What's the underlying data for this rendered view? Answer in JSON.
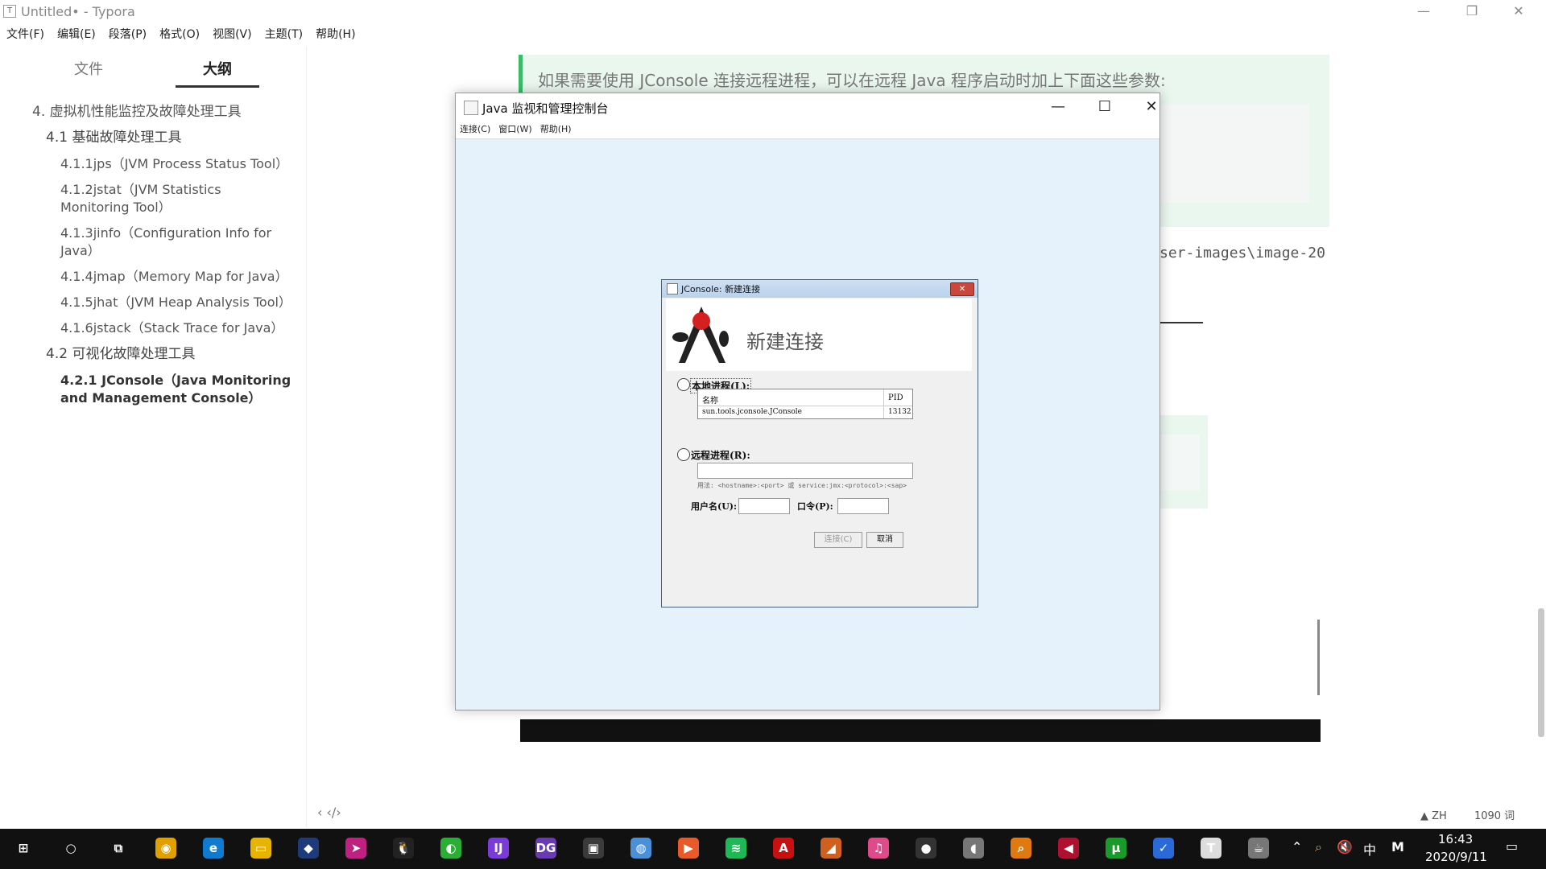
{
  "typora": {
    "title": "Untitled• - Typora",
    "controls": {
      "minimize": "—",
      "restore": "❐",
      "close": "✕"
    },
    "menu": [
      "文件(F)",
      "编辑(E)",
      "段落(P)",
      "格式(O)",
      "视图(V)",
      "主题(T)",
      "帮助(H)"
    ],
    "sidebar_tabs": {
      "files": "文件",
      "outline": "大纲"
    },
    "outline": [
      {
        "text": "4. 虚拟机性能监控及故障处理工具",
        "level": 1
      },
      {
        "text": "4.1 基础故障处理工具",
        "level": 2
      },
      {
        "text": "4.1.1jps（JVM Process Status Tool）",
        "level": 3
      },
      {
        "text": "4.1.2jstat（JVM Statistics Monitoring Tool）",
        "level": 3
      },
      {
        "text": "4.1.3jinfo（Configuration Info for Java）",
        "level": 3
      },
      {
        "text": "4.1.4jmap（Memory Map for Java）",
        "level": 3
      },
      {
        "text": "4.1.5jhat（JVM Heap Analysis Tool）",
        "level": 3
      },
      {
        "text": "4.1.6jstack（Stack Trace for Java）",
        "level": 3
      },
      {
        "text": "4.2 可视化故障处理工具",
        "level": 2
      },
      {
        "text": "4.2.1 JConsole（Java Monitoring and Management Console）",
        "level": 3,
        "active": true
      }
    ],
    "blockquote": "如果需要使用 JConsole 连接远程进程，可以在远程 Java 程序启动时加上下面这些参数:",
    "path_fragment": "ser-images\\image-20",
    "status": {
      "left_icons": "‹  ‹/›",
      "lang": "ZH",
      "word_count": "1090 词"
    }
  },
  "java_window": {
    "title": "Java 监视和管理控制台",
    "controls": {
      "minimize": "—",
      "maximize": "☐",
      "close": "✕"
    },
    "menu": [
      "连接(C)",
      "窗口(W)",
      "帮助(H)"
    ]
  },
  "dialog": {
    "title": "JConsole: 新建连接",
    "close": "✕",
    "heading": "新建连接",
    "local_label": "本地进程(L):",
    "table_headers": {
      "name": "名称",
      "pid": "PID"
    },
    "process": {
      "name": "sun.tools.jconsole.JConsole",
      "pid": "13132"
    },
    "remote_label": "远程进程(R):",
    "remote_value": "",
    "usage": "用法: <hostname>:<port> 或 service:jmx:<protocol>:<sap>",
    "username_label": "用户名(U):",
    "password_label": "口令(P):",
    "connect_btn": "连接(C)",
    "cancel_btn": "取消"
  },
  "taskbar": {
    "time": "16:43",
    "date": "2020/9/11",
    "ime": "中",
    "ime2": "M",
    "icons": [
      {
        "name": "windows-start-icon",
        "color": "#111",
        "glyph": "⊞"
      },
      {
        "name": "cortana-icon",
        "color": "#111",
        "glyph": "○"
      },
      {
        "name": "task-view-icon",
        "color": "#111",
        "glyph": "⧉"
      },
      {
        "name": "chrome-icon",
        "color": "#e0a000",
        "glyph": "◉"
      },
      {
        "name": "edge-icon",
        "color": "#0f7bd0",
        "glyph": "e"
      },
      {
        "name": "file-explorer-icon",
        "color": "#e8b400",
        "glyph": "▭"
      },
      {
        "name": "app-icon-cat",
        "color": "#1f3a7a",
        "glyph": "◆"
      },
      {
        "name": "app-icon-arrow",
        "color": "#c02080",
        "glyph": "➤"
      },
      {
        "name": "qq-icon",
        "color": "#222",
        "glyph": "🐧"
      },
      {
        "name": "wechat-icon",
        "color": "#2aae36",
        "glyph": "◐"
      },
      {
        "name": "intellij-icon",
        "color": "#7a3bd8",
        "glyph": "IJ"
      },
      {
        "name": "datagrip-icon",
        "color": "#6a3ab0",
        "glyph": "DG"
      },
      {
        "name": "screenshot-tool-icon",
        "color": "#3a3a3a",
        "glyph": "▣"
      },
      {
        "name": "browser-globe-icon",
        "color": "#4a90d9",
        "glyph": "◍"
      },
      {
        "name": "media-player-icon",
        "color": "#e85a2a",
        "glyph": "▶"
      },
      {
        "name": "spotify-icon",
        "color": "#1db954",
        "glyph": "≋"
      },
      {
        "name": "acrobat-icon",
        "color": "#c81010",
        "glyph": "A"
      },
      {
        "name": "matlab-icon",
        "color": "#d06020",
        "glyph": "◢"
      },
      {
        "name": "itunes-icon",
        "color": "#e04a8a",
        "glyph": "♫"
      },
      {
        "name": "app-icon-dark",
        "color": "#333",
        "glyph": "●"
      },
      {
        "name": "app-icon-fox",
        "color": "#777",
        "glyph": "◖"
      },
      {
        "name": "search-tool-icon",
        "color": "#e07a10",
        "glyph": "⌕"
      },
      {
        "name": "git-tool-icon",
        "color": "#b01030",
        "glyph": "◀"
      },
      {
        "name": "utorrent-icon",
        "color": "#1a9a2a",
        "glyph": "μ"
      },
      {
        "name": "todo-icon",
        "color": "#2a6ad8",
        "glyph": "✓"
      },
      {
        "name": "typora-icon",
        "color": "#ddd",
        "glyph": "T"
      },
      {
        "name": "java-icon",
        "color": "#777",
        "glyph": "☕"
      }
    ]
  }
}
